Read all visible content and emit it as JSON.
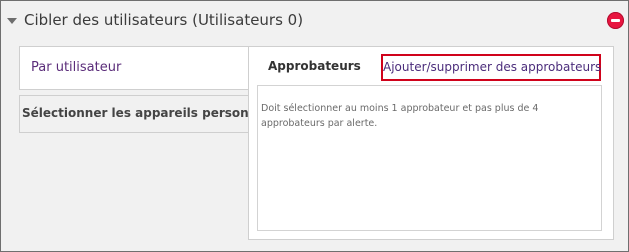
{
  "section": {
    "title": "Cibler des utilisateurs (Utilisateurs 0)",
    "remove_icon": "remove-circle-icon",
    "remove_color": "#e8153f"
  },
  "nav": {
    "by_user": "Par utilisateur",
    "select_devices": "Sélectionner les appareils personnels"
  },
  "approvers": {
    "title": "Approbateurs",
    "add_remove_label": "Ajouter/supprimer des approbateurs",
    "info_text": "Doit sélectionner au moins 1 approbateur et pas plus de 4 approbateurs par alerte."
  },
  "colors": {
    "accent_text": "#5b2d7a",
    "highlight_border": "#d0021b"
  }
}
